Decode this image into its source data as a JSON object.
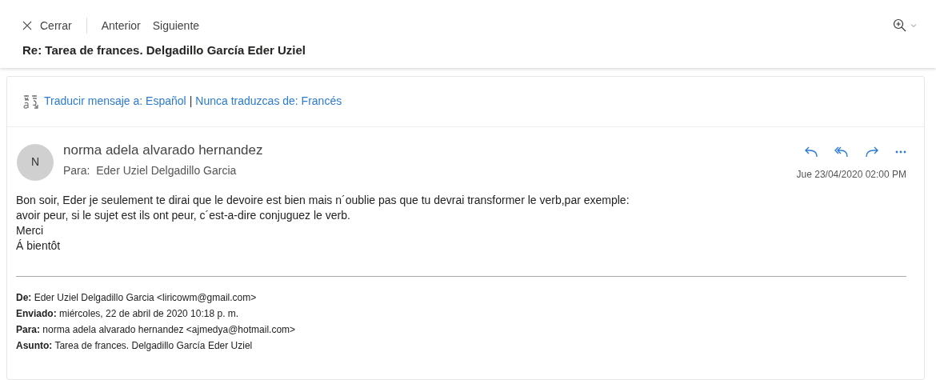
{
  "toolbar": {
    "close": "Cerrar",
    "previous": "Anterior",
    "next": "Siguiente"
  },
  "subject": "Re: Tarea de frances. Delgadillo García Eder Uziel",
  "translate_bar": {
    "translate_link": "Traducir mensaje a: Español",
    "separator": "|",
    "never_link": "Nunca traduzcas de: Francés"
  },
  "message": {
    "avatar_initial": "N",
    "sender": "norma adela alvarado hernandez",
    "to": "Para:  Eder Uziel Delgadillo Garcia",
    "date": "Jue 23/04/2020 02:00 PM",
    "body": [
      "Bon soir, Eder je seulement te dirai que le devoire est bien mais n´oublie pas que tu devrai transformer le verb,par exemple:",
      "avoir peur, si le sujet est ils ont peur, c´est-a-dire conjuguez le verb.",
      "Merci",
      "Á bientôt"
    ],
    "quoted_headers": [
      "**De:** Eder Uziel Delgadillo Garcia <liricowm@gmail.com>",
      "**Enviado:** miércoles, 22 de abril de 2020 10:18 p. m.",
      "**Para:** norma adela alvarado hernandez <ajmedya@hotmail.com>",
      "**Asunto:** Tarea de frances. Delgadillo García Eder Uziel"
    ]
  }
}
